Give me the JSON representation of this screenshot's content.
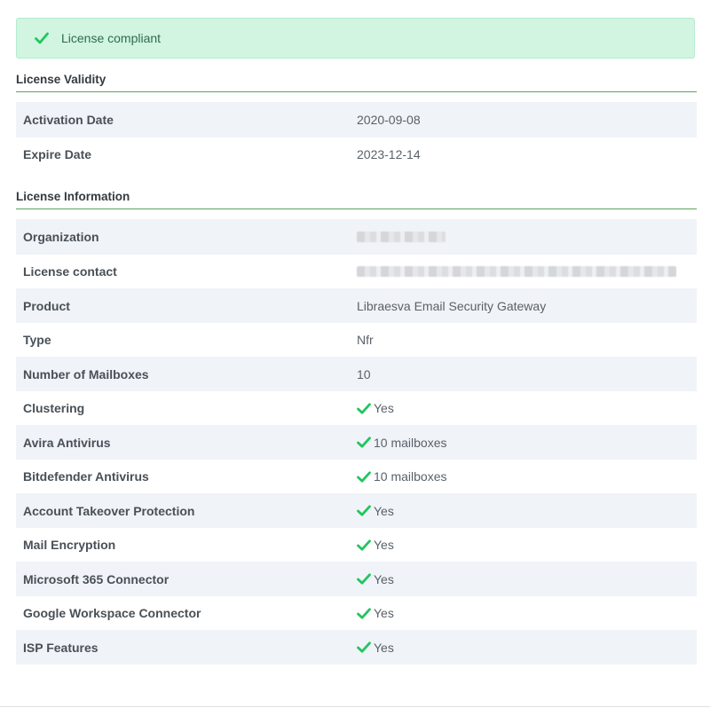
{
  "alert": {
    "text": "License compliant",
    "icon": "check-icon",
    "color": "#22c55e"
  },
  "validity": {
    "title": "License Validity",
    "rows": [
      {
        "key": "Activation Date",
        "value": "2020-09-08"
      },
      {
        "key": "Expire Date",
        "value": "2023-12-14"
      }
    ]
  },
  "information": {
    "title": "License Information",
    "rows": [
      {
        "key": "Organization",
        "value": "",
        "redacted": true
      },
      {
        "key": "License contact",
        "value": "",
        "redacted": true
      },
      {
        "key": "Product",
        "value": "Libraesva Email Security Gateway"
      },
      {
        "key": "Type",
        "value": "Nfr"
      },
      {
        "key": "Number of Mailboxes",
        "value": "10"
      },
      {
        "key": "Clustering",
        "value": "Yes",
        "check": true
      },
      {
        "key": "Avira Antivirus",
        "value": "10 mailboxes",
        "check": true
      },
      {
        "key": "Bitdefender Antivirus",
        "value": "10 mailboxes",
        "check": true
      },
      {
        "key": "Account Takeover Protection",
        "value": "Yes",
        "check": true
      },
      {
        "key": "Mail Encryption",
        "value": "Yes",
        "check": true
      },
      {
        "key": "Microsoft 365 Connector",
        "value": "Yes",
        "check": true
      },
      {
        "key": "Google Workspace Connector",
        "value": "Yes",
        "check": true
      },
      {
        "key": "ISP Features",
        "value": "Yes",
        "check": true
      }
    ]
  }
}
